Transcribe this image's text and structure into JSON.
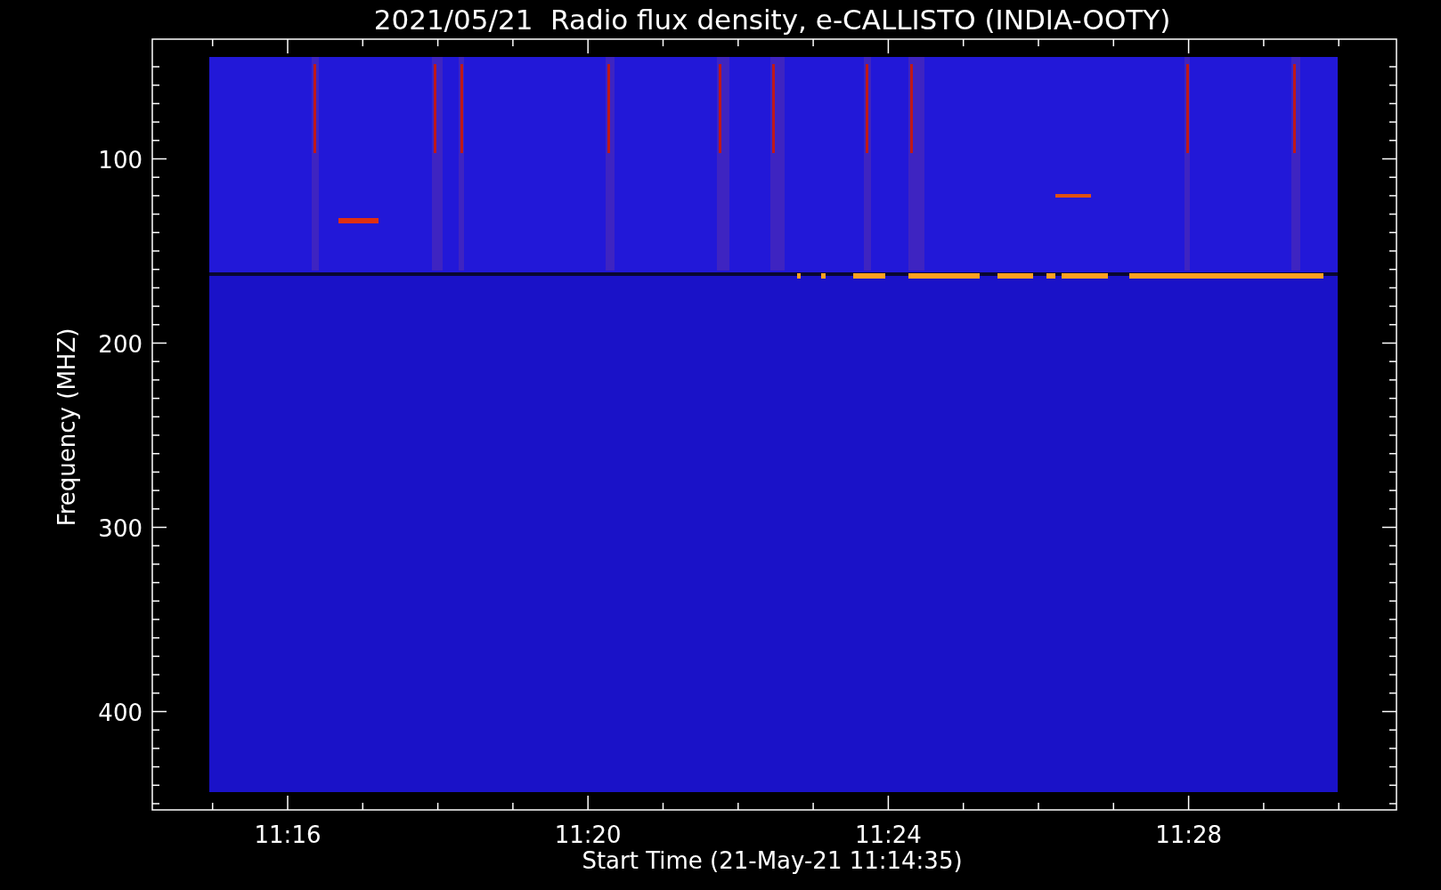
{
  "title": "2021/05/21  Radio flux density, e-CALLISTO (INDIA-OOTY)",
  "y_axis": {
    "label": "Frequency (MHZ)",
    "ticks": [
      "100",
      "200",
      "300",
      "400"
    ]
  },
  "x_axis": {
    "label": "Start Time (21-May-21 11:14:35)",
    "ticks": [
      "11:16",
      "11:20",
      "11:24",
      "11:28"
    ]
  }
}
